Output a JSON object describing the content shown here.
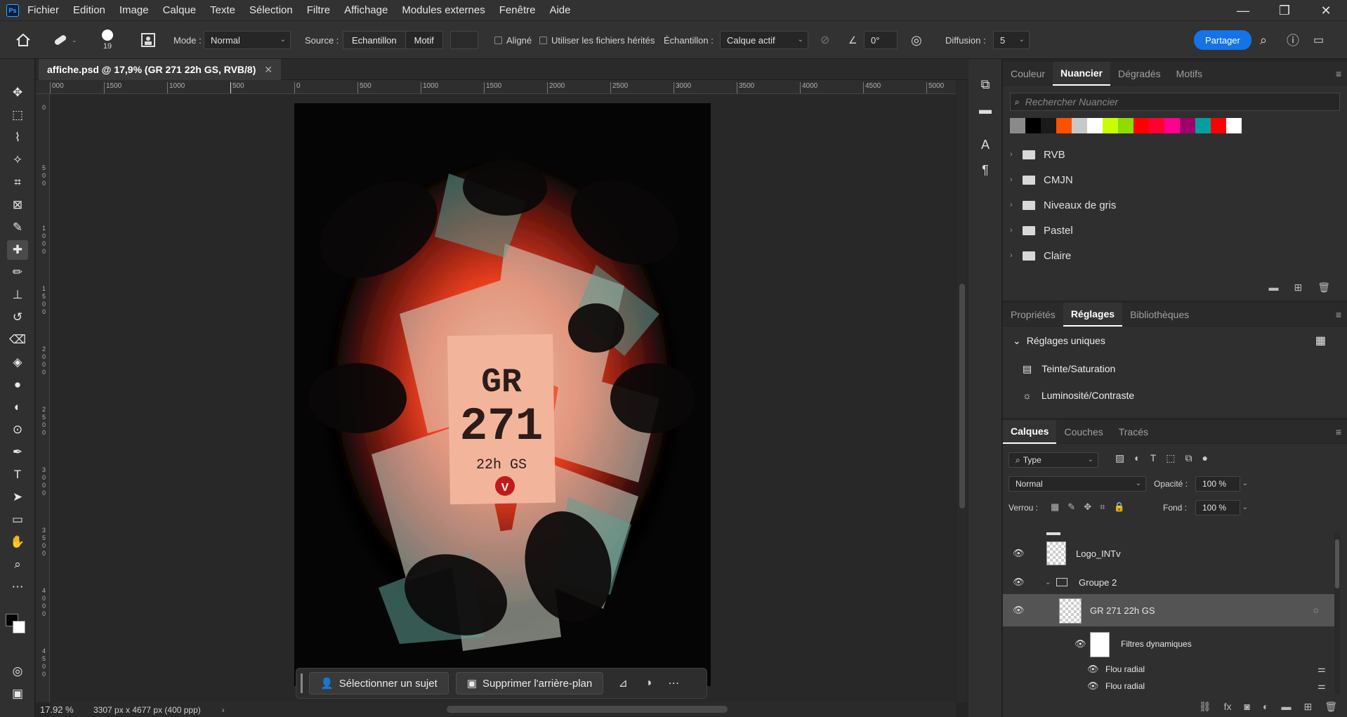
{
  "app": {
    "logo": "Ps"
  },
  "menu": [
    "Fichier",
    "Edition",
    "Image",
    "Calque",
    "Texte",
    "Sélection",
    "Filtre",
    "Affichage",
    "Modules externes",
    "Fenêtre",
    "Aide"
  ],
  "window_controls": {
    "minimize": "—",
    "restore": "❐",
    "close": "✕"
  },
  "options": {
    "brush_size": "19",
    "mode_label": "Mode :",
    "mode_value": "Normal",
    "source_label": "Source :",
    "source_sample": "Echantillon",
    "source_pattern": "Motif",
    "aligned": "Aligné",
    "use_legacy": "Utiliser les fichiers hérités",
    "sample_label": "Échantillon :",
    "sample_value": "Calque actif",
    "angle_value": "0°",
    "diffusion_label": "Diffusion :",
    "diffusion_value": "5",
    "share": "Partager"
  },
  "document": {
    "tab_title": "affiche.psd @ 17,9% (GR 271 22h GS, RVB/8)",
    "zoom": "17.92 %",
    "dims": "3307 px x 4677 px (400 ppp)"
  },
  "ruler": {
    "h_ticks": [
      "000",
      "1500",
      "1000",
      "500",
      "0",
      "500",
      "1000",
      "1500",
      "2000",
      "2500",
      "3000",
      "3500",
      "4000",
      "4500",
      "5000"
    ],
    "v_ticks": [
      "0",
      "500",
      "1000",
      "1500",
      "2000",
      "2500",
      "3000",
      "3500",
      "4000",
      "4500"
    ]
  },
  "poster": {
    "line1": "GR",
    "line2": "271",
    "line3": "22h GS",
    "logo_letter": "V"
  },
  "contextual_bar": {
    "select_subject": "Sélectionner un sujet",
    "remove_bg": "Supprimer l'arrière-plan"
  },
  "swatches_panel": {
    "tabs": [
      "Couleur",
      "Nuancier",
      "Dégradés",
      "Motifs"
    ],
    "active_tab": "Nuancier",
    "search_placeholder": "Rechercher Nuancier",
    "colors": [
      "#8a8a8a",
      "#000000",
      "#1a1a1a",
      "#ff4f00",
      "#c8c8c8",
      "#ffffff",
      "#c8ff00",
      "#8cdc00",
      "#ff0000",
      "#ff0033",
      "#ff0090",
      "#a0006a",
      "#00a0a0",
      "#ff0000",
      "#ffffff"
    ],
    "folders": [
      "RVB",
      "CMJN",
      "Niveaux de gris",
      "Pastel",
      "Claire"
    ]
  },
  "adjust_panel": {
    "tabs": [
      "Propriétés",
      "Réglages",
      "Bibliothèques"
    ],
    "active_tab": "Réglages",
    "section": "Réglages uniques",
    "items": [
      "Teinte/Saturation",
      "Luminosité/Contraste"
    ]
  },
  "layers_panel": {
    "tabs": [
      "Calques",
      "Couches",
      "Tracés"
    ],
    "active_tab": "Calques",
    "filter": "Type",
    "blend": "Normal",
    "opacity_label": "Opacité :",
    "opacity": "100 %",
    "lock_label": "Verrou :",
    "fill_label": "Fond :",
    "fill": "100 %",
    "layers": [
      "Logo_INTv",
      "Groupe 2",
      "GR 271 22h GS",
      "Filtres dynamiques",
      "Flou radial",
      "Flou radial"
    ]
  }
}
